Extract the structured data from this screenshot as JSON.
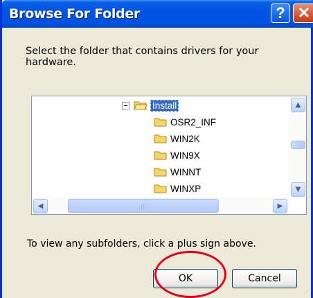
{
  "window": {
    "title": "Browse For Folder",
    "help_glyph": "?",
    "close_glyph": "✕"
  },
  "prompt": "Select the folder that contains drivers for your hardware.",
  "tree": {
    "items": [
      {
        "label": "Install",
        "selected": true,
        "expanded": true
      },
      {
        "label": "OSR2_INF"
      },
      {
        "label": "WIN2K"
      },
      {
        "label": "WIN9X"
      },
      {
        "label": "WINNT"
      },
      {
        "label": "WINXP"
      }
    ]
  },
  "hint": "To view any subfolders, click a plus sign above.",
  "buttons": {
    "ok": "OK",
    "cancel": "Cancel"
  },
  "colors": {
    "title_bar": "#0054e3",
    "selection": "#316ac5",
    "annotation_circle": "#e0001a"
  }
}
